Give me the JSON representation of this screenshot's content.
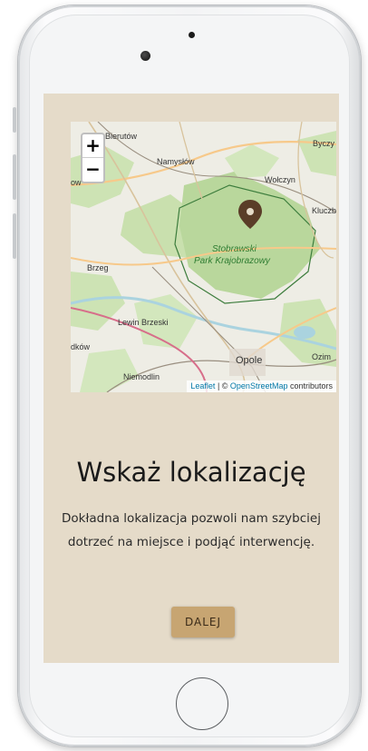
{
  "map": {
    "zoom_in_label": "+",
    "zoom_out_label": "−",
    "attribution": {
      "leaflet": "Leaflet",
      "separator": " | © ",
      "osm": "OpenStreetMap",
      "suffix": " contributors"
    },
    "places": {
      "bierutow": "Bierutów",
      "namyslow": "Namysłów",
      "byczyna": "Byczy",
      "wolczyn": "Wołczyn",
      "kluczbork": "Kluczb",
      "ow": "ow",
      "park_line1": "Stobrawski",
      "park_line2": "Park Krajobrazowy",
      "brzeg": "Brzeg",
      "lewin": "Lewin Brzeski",
      "dkow": "dków",
      "opole": "Opole",
      "ozim": "Ozim",
      "niemodlin": "Niemodlin"
    },
    "marker_color": "#5a3d28"
  },
  "content": {
    "title": "Wskaż lokalizację",
    "description": "Dokładna lokalizacja pozwoli nam szybciej dotrzeć na miejsce i podjąć interwencję.",
    "next_button": "DALEJ"
  },
  "theme": {
    "screen_bg": "#e5dbc9",
    "button_bg": "#c7a572"
  }
}
